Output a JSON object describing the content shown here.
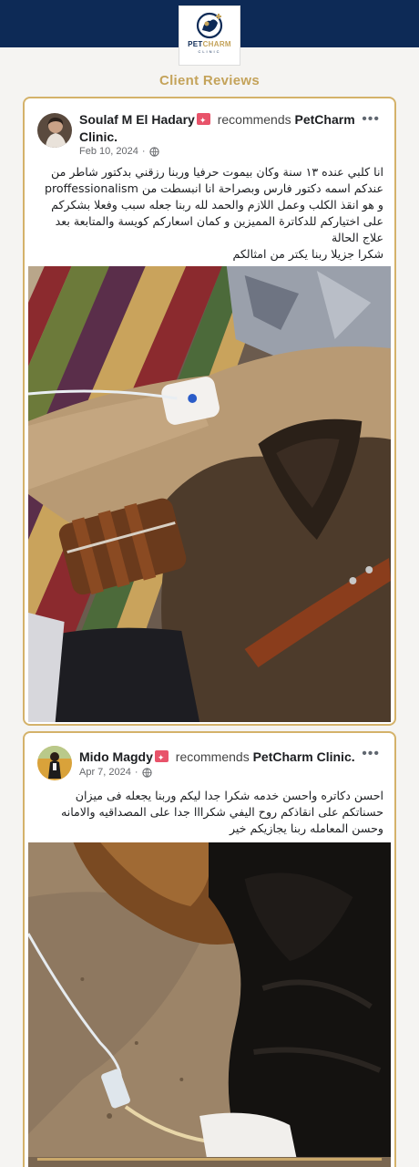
{
  "header": {
    "logo_pet": "PET",
    "logo_charm": "CHARM",
    "logo_sub": "CLINIC",
    "logo_icon": "pet-clinic-logo-icon"
  },
  "section": {
    "title": "Client Reviews"
  },
  "reviews": [
    {
      "author": "Soulaf M El Hadary",
      "recommends": "recommends",
      "page": "PetCharm Clinic.",
      "date": "Feb 10, 2024",
      "separator": "·",
      "more_icon": "more-options-icon",
      "lines": [
        "انا كلبي عنده ١٣ سنة وكان بيموت حرفيا وربنا رزقني بدكتور شاطر من",
        "عندكم اسمه دكتور فارس وبصراحة انا انبسطت من proffessionalism",
        "و هو انقذ الكلب وعمل اللازم والحمد لله ربنا جعله سبب وفعلا بشكركم",
        "على اختياركم للدكاترة المميزين و كمان اسعاركم كويسة والمتابعة بعد",
        "علاج الحالة",
        "شكرا جزيلا ربنا يكتر من امثالكم"
      ],
      "photo": "dog-with-iv-drip-on-rug-photo"
    },
    {
      "author": "Mido Magdy",
      "recommends": "recommends",
      "page": "PetCharm Clinic.",
      "date": "Apr 7, 2024",
      "separator": "·",
      "more_icon": "more-options-icon",
      "lines": [
        "احسن دكاتره واحسن خدمه شكرا جدا ليكم وربنا يجعله فى ميزان",
        "حسناتكم على انقاذكم روح اليفي شكرااا جدا على المصداقيه والامانه",
        "وحسن المعامله ربنا يجازيكم خير"
      ],
      "photo": "dog-with-iv-drip-on-ground-photo"
    }
  ],
  "colors": {
    "navy": "#0d2a56",
    "gold": "#c4a35a",
    "badge": "#e8536a"
  }
}
